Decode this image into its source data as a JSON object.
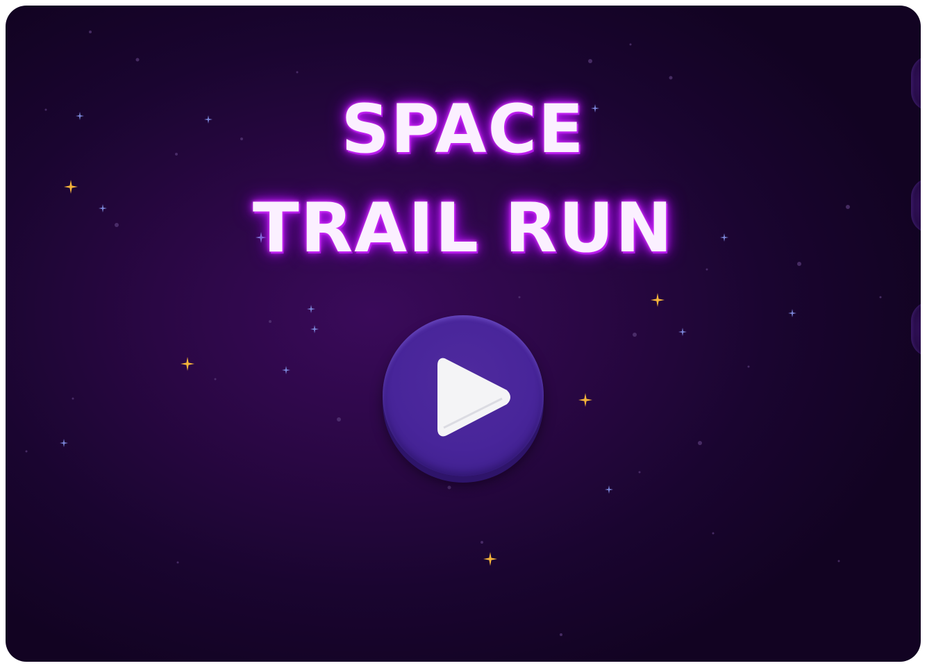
{
  "game": {
    "title_line_1": "SPACE",
    "title_line_2": "TRAIL RUN",
    "play_button_icon": "play-icon",
    "side_tabs": [
      "side-tab",
      "side-tab",
      "side-tab"
    ]
  },
  "colors": {
    "background_deep": "#120322",
    "background_glow": "#3a0a5a",
    "title_text": "#fbf0ff",
    "title_glow": "#c020f0",
    "play_button": "#48259a",
    "play_button_shadow": "#2e146a",
    "play_icon": "#f4f4f6",
    "star_gold": "#f5b43a",
    "star_blue": "#7b86d8"
  }
}
